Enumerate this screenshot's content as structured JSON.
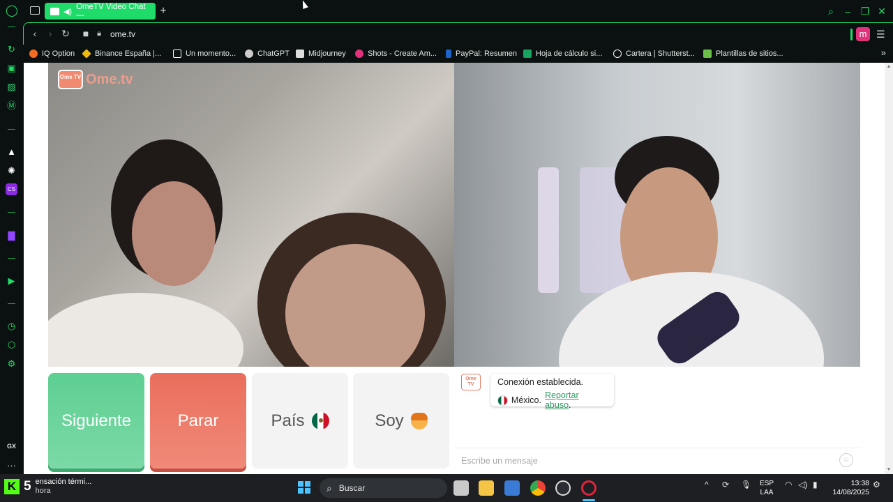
{
  "browser": {
    "tab_title": "OmeTV Video Chat —",
    "new_tab_symbol": "+",
    "url": "ome.tv",
    "profile_initial": "m",
    "accent_color": "#1fdc6a",
    "sidebar_icons": [
      "opera-gx-logo-icon",
      "history-icon",
      "bag-icon",
      "gx-corner-icon",
      "messenger-icon",
      "arc-icon",
      "chatgpt-icon",
      "cs-icon",
      "twitch-icon",
      "player-icon",
      "clock-icon",
      "extensions-icon",
      "settings-icon",
      "more-icon"
    ],
    "sidebar_label_gx": "GX",
    "sidebar_more": "···"
  },
  "bookmarks": [
    {
      "label": "IQ Option",
      "color": "#f36c21"
    },
    {
      "label": "Binance España |...",
      "color": "#f0b90b"
    },
    {
      "label": "Un momento...",
      "color": "#ffffff"
    },
    {
      "label": "ChatGPT",
      "color": "#cccccc"
    },
    {
      "label": "Midjourney",
      "color": "#dddddd"
    },
    {
      "label": "Shots - Create Am...",
      "color": "#e0337c"
    },
    {
      "label": "PayPal: Resumen",
      "color": "#1e63c7"
    },
    {
      "label": "Hoja de cálculo si...",
      "color": "#1aa260"
    },
    {
      "label": "Cartera | Shutterst...",
      "color": "#ffffff"
    },
    {
      "label": "Plantillas de sitios...",
      "color": "#6cc04a"
    }
  ],
  "ometv": {
    "logo_tv": "Ome TV",
    "logo_text": "Ome.tv",
    "buttons": {
      "next": "Siguiente",
      "stop": "Parar",
      "country": "País",
      "me": "Soy"
    },
    "chat": {
      "status": "Conexión establecida.",
      "country": "México.",
      "report_link": "Reportar abuso",
      "report_end": ".",
      "input_placeholder": "Escribe un mensaje"
    }
  },
  "taskbar": {
    "weather_title": "ensación térmi...",
    "weather_sub": "hora",
    "kick_number": "5",
    "search_label": "Buscar",
    "lang_1": "ESP",
    "lang_2": "LAA",
    "time": "13:38",
    "date": "14/08/2025"
  }
}
